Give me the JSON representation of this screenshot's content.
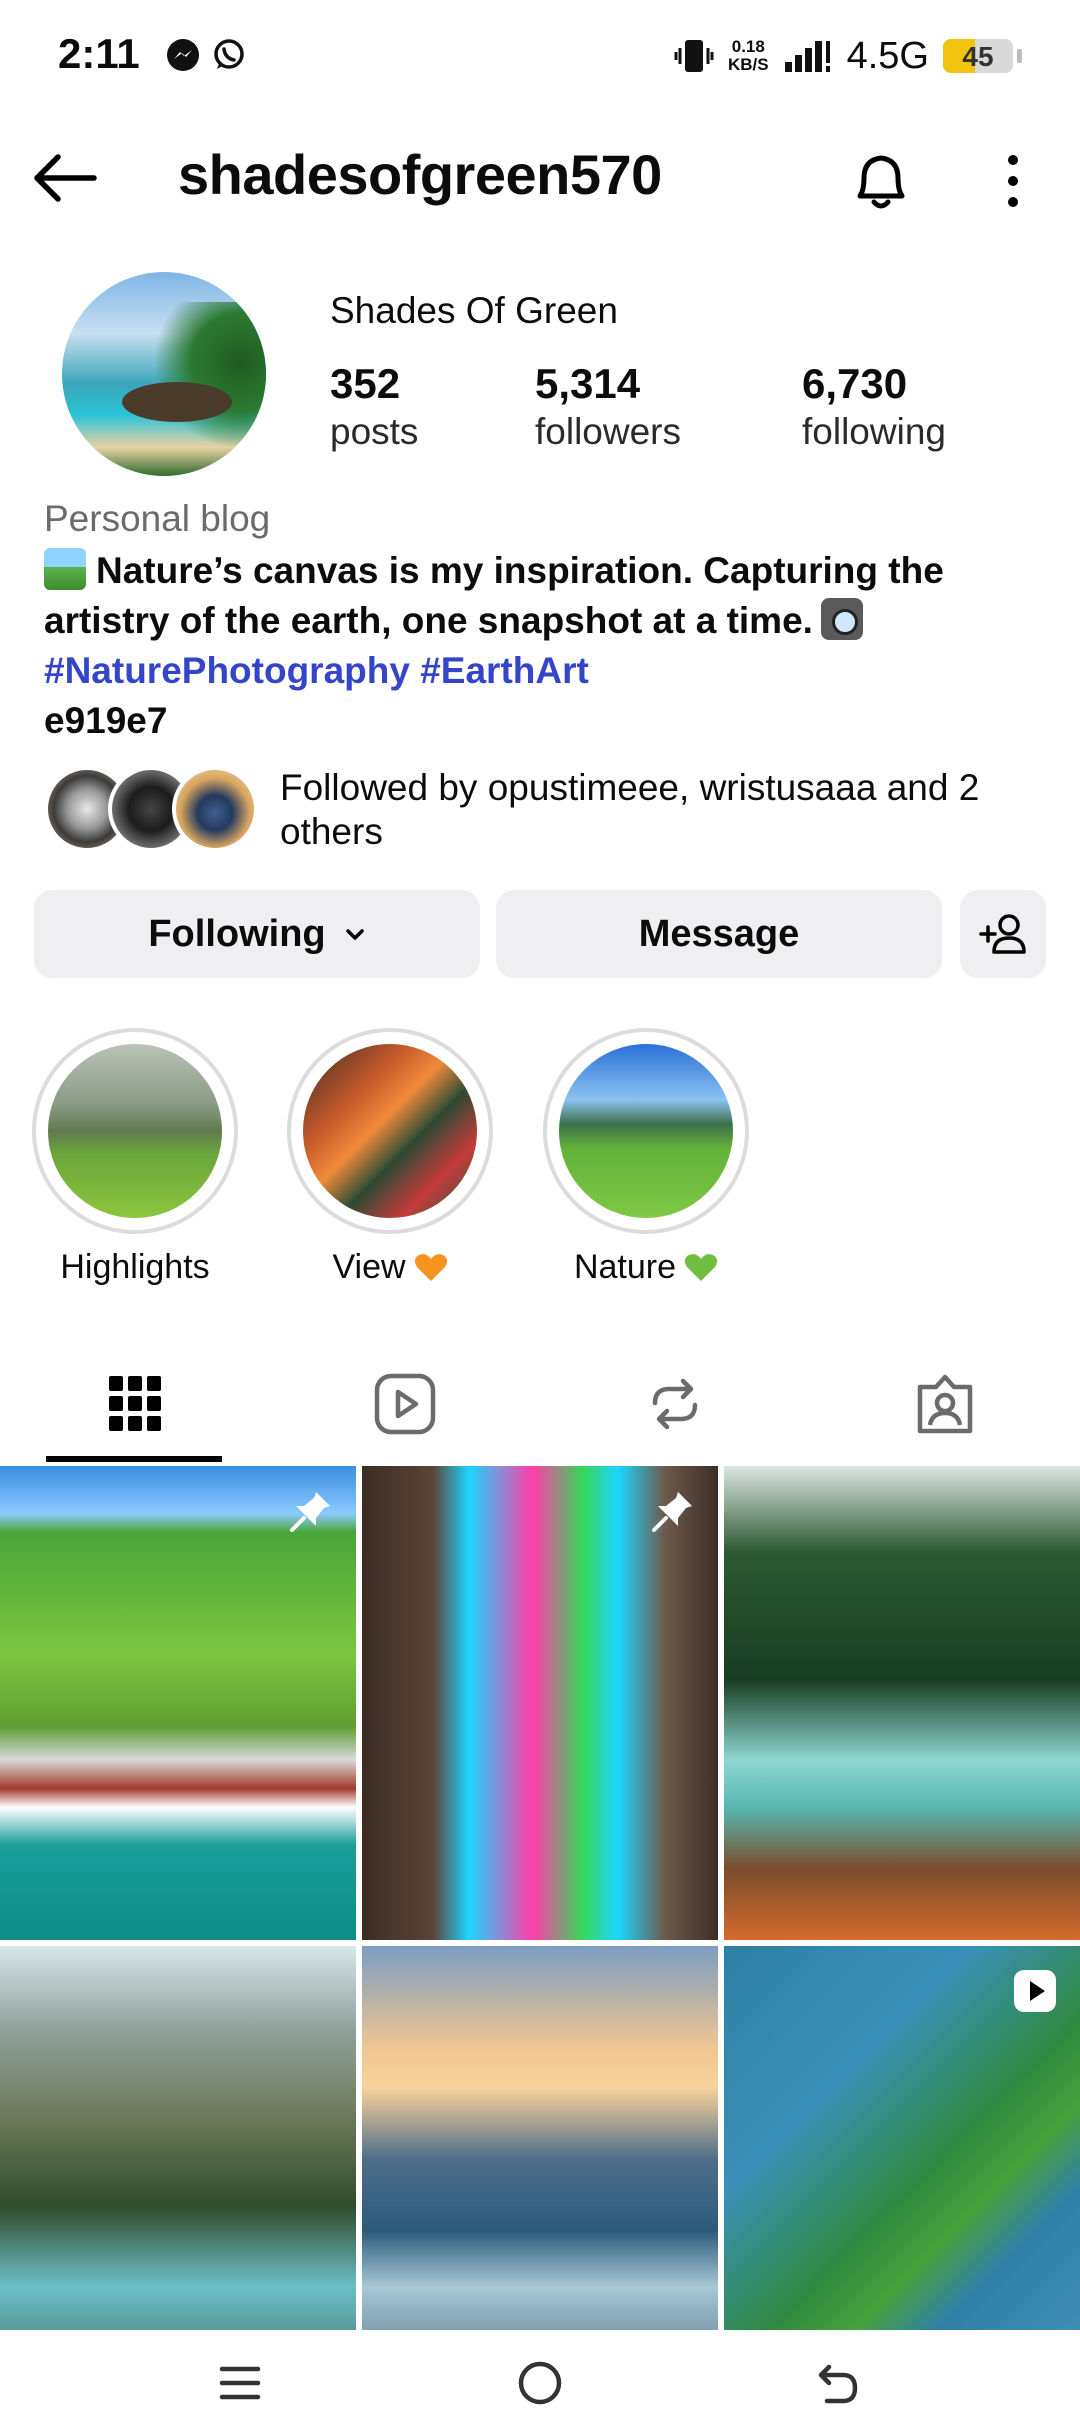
{
  "status_bar": {
    "time": "2:11",
    "speed_value": "0.18",
    "speed_unit": "KB/S",
    "network": "4.5G",
    "battery": "45",
    "battery_level": 0.45,
    "notification_icons": [
      "messenger-icon",
      "whatsapp-icon"
    ]
  },
  "header": {
    "username": "shadesofgreen570"
  },
  "profile": {
    "display_name": "Shades Of Green",
    "stats": [
      {
        "value": "352",
        "label": "posts"
      },
      {
        "value": "5,314",
        "label": "followers"
      },
      {
        "value": "6,730",
        "label": "following"
      }
    ],
    "category": "Personal blog",
    "bio_line1": "Nature’s canvas is my inspiration. Capturing the artistry of the earth, one snapshot at a time.",
    "hashtag1": "#NaturePhotography",
    "hashtag2": "#EarthArt",
    "bio_code": "e919e7",
    "mutual_prefix": "Followed by ",
    "mutual_names": "opustimeee, wristusaaa",
    "mutual_suffix": " and 2 others"
  },
  "actions": {
    "following_label": "Following",
    "message_label": "Message"
  },
  "highlights": [
    {
      "label": "Highlights"
    },
    {
      "label": "View"
    },
    {
      "label": "Nature"
    }
  ],
  "tabs": [
    "grid-icon",
    "reels-icon",
    "reposts-icon",
    "tagged-icon"
  ],
  "colors": {
    "hashtag": "#3445c9",
    "button_bg": "#efeff1",
    "battery": "#f1c40f"
  }
}
